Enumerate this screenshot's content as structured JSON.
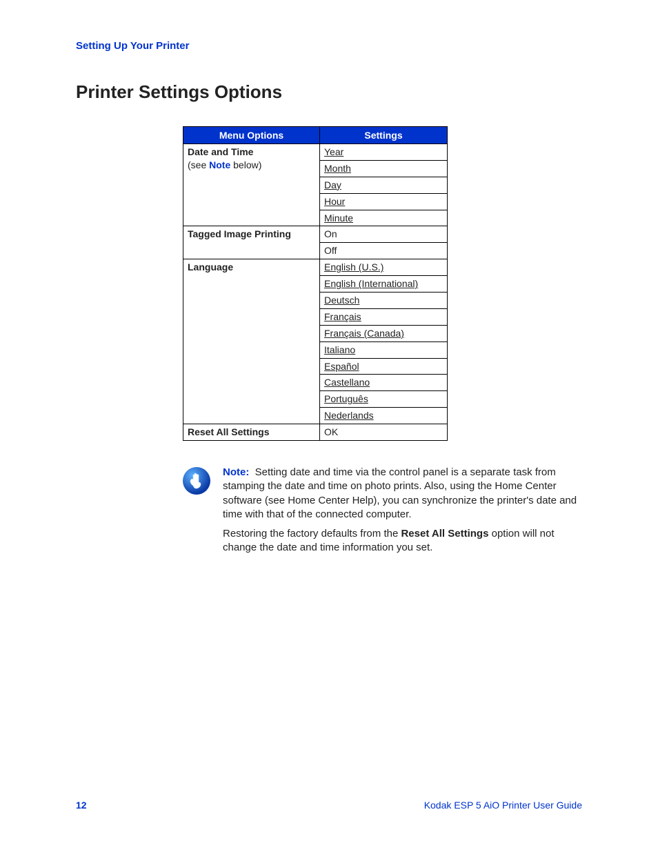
{
  "header_link": "Setting Up Your Printer",
  "title": "Printer Settings Options",
  "table": {
    "head": {
      "menu": "Menu Options",
      "settings": "Settings"
    },
    "rows": [
      {
        "menu_bold": "Date and Time",
        "menu_extra_pre": "(see ",
        "menu_extra_link": "Note",
        "menu_extra_post": " below)",
        "settings": [
          "Year",
          "Month",
          "Day",
          "Hour",
          "Minute"
        ],
        "underline": true
      },
      {
        "menu_bold": "Tagged Image Printing",
        "settings": [
          "On",
          "Off"
        ],
        "underline": false
      },
      {
        "menu_bold": "Language",
        "settings": [
          "English (U.S.)",
          "English (International)",
          "Deutsch",
          "Français",
          "Français (Canada)",
          "Italiano",
          "Español",
          "Castellano",
          "Português",
          "Nederlands"
        ],
        "underline": true
      },
      {
        "menu_bold": "Reset All Settings",
        "settings": [
          "OK"
        ],
        "underline": false
      }
    ]
  },
  "note": {
    "label": "Note:",
    "para1_a": "Setting date and time via the control panel is a separate task from stamping the date and time on photo prints. Also, using the Home Center software (see Home Center Help), you can synchronize the printer's date and time with that of the connected computer.",
    "para2_a": "Restoring the factory defaults from the ",
    "para2_bold": "Reset All Settings",
    "para2_b": " option will not change the date and time information you set."
  },
  "footer": {
    "page": "12",
    "guide": "Kodak ESP 5 AiO Printer User Guide"
  }
}
